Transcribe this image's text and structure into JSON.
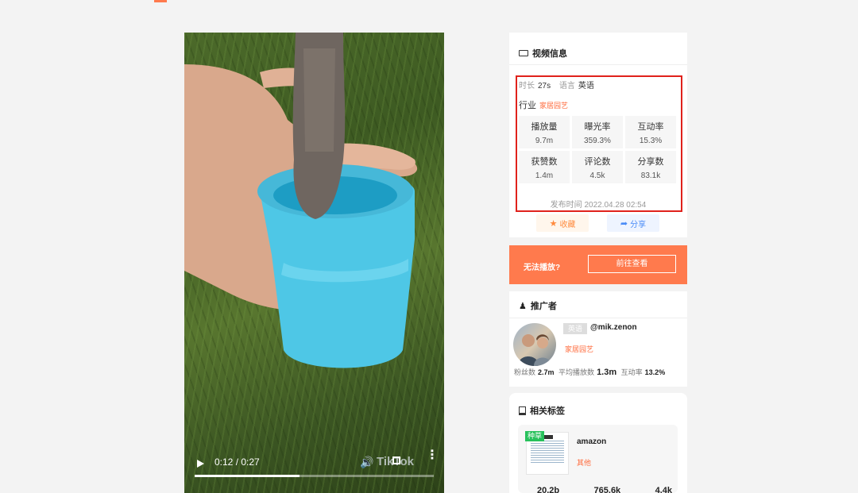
{
  "video": {
    "current_time": "0:12",
    "duration": "0:27",
    "time_separator": " / ",
    "progress": 0.44,
    "watermark": "TikTok"
  },
  "info": {
    "title": "视频信息",
    "duration_label": "时长",
    "duration_value": "27s",
    "language_label": "语言",
    "language_value": "英语",
    "industry_label": "行业",
    "industry_value": "家居园艺",
    "stats": [
      {
        "label": "播放量",
        "value": "9.7m"
      },
      {
        "label": "曝光率",
        "value": "359.3%"
      },
      {
        "label": "互动率",
        "value": "15.3%"
      },
      {
        "label": "获赞数",
        "value": "1.4m"
      },
      {
        "label": "评论数",
        "value": "4.5k"
      },
      {
        "label": "分享数",
        "value": "83.1k"
      }
    ],
    "publish_label": "发布时间",
    "publish_time": "2022.04.28 02:54",
    "fav_label": "收藏",
    "share_label": "分享"
  },
  "banner": {
    "text": "无法播放?",
    "button": "前往查看"
  },
  "promoter": {
    "title": "推广者",
    "lang_badge": "英语",
    "handle": "@mik.zenon",
    "category": "家居园艺",
    "followers_label": "粉丝数",
    "followers_value": "2.7m",
    "avg_views_label": "平均播放数",
    "avg_views_value": "1.3m",
    "engagement_label": "互动率",
    "engagement_value": "13.2%"
  },
  "tags": {
    "title": "相关标签",
    "badge": "种草",
    "name": "amazon",
    "category": "其他",
    "nums": [
      "20.2b",
      "765.6k",
      "4.4k"
    ]
  },
  "colors": {
    "accent": "#ff7a4d",
    "highlight_border": "#e0221c",
    "tag_orange": "#ff6b3d",
    "seed_green": "#27c15b"
  }
}
